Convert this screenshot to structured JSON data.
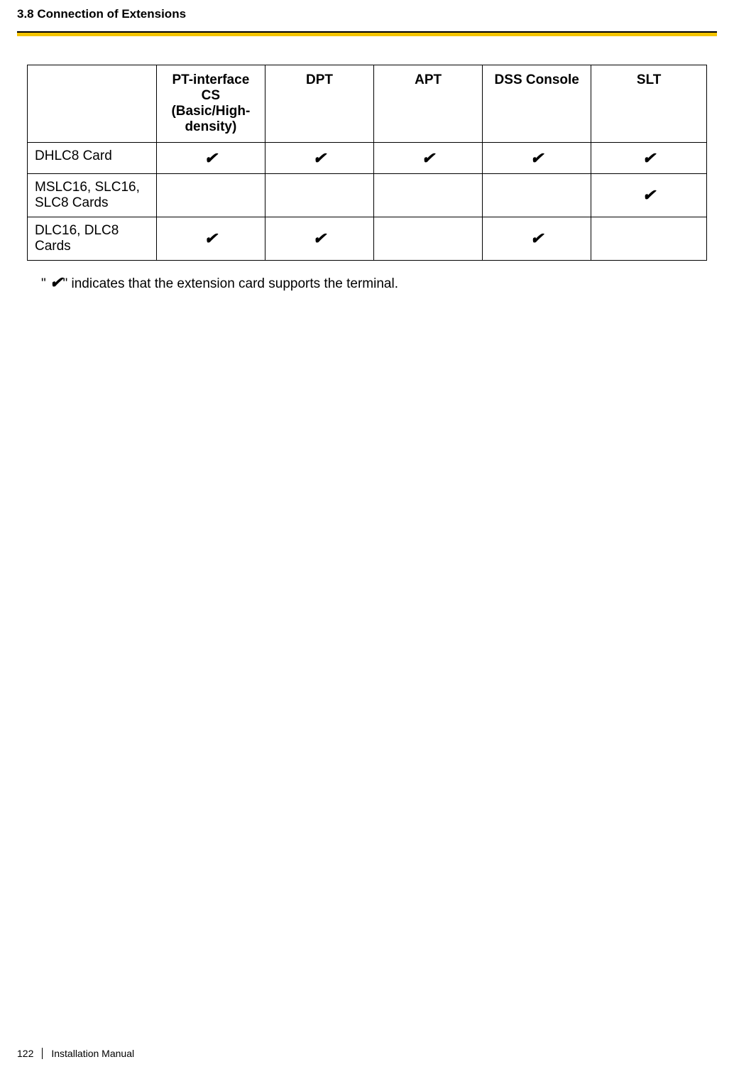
{
  "header": {
    "section_title": "3.8 Connection of Extensions"
  },
  "table": {
    "columns": [
      "",
      "PT-interface CS (Basic/High-density)",
      "DPT",
      "APT",
      "DSS Console",
      "SLT"
    ],
    "rows": [
      {
        "label": "DHLC8 Card",
        "cells": [
          "✔",
          "✔",
          "✔",
          "✔",
          "✔"
        ]
      },
      {
        "label": "MSLC16, SLC16, SLC8 Cards",
        "cells": [
          "",
          "",
          "",
          "",
          "✔"
        ]
      },
      {
        "label": "DLC16, DLC8 Cards",
        "cells": [
          "✔",
          "✔",
          "",
          "✔",
          ""
        ]
      }
    ]
  },
  "note": {
    "prefix": "\" ",
    "check": "✔",
    "suffix": "\" indicates that the extension card supports the terminal."
  },
  "footer": {
    "page": "122",
    "manual": "Installation Manual"
  }
}
